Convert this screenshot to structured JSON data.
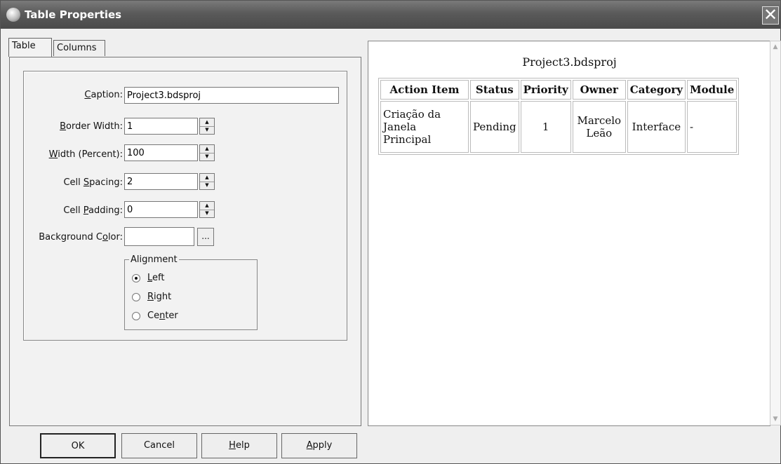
{
  "window": {
    "title": "Table Properties",
    "close_glyph": "✕"
  },
  "tabs": [
    {
      "label": "Table"
    },
    {
      "label": "Columns"
    }
  ],
  "form": {
    "caption": {
      "label_pre": "",
      "label_u": "C",
      "label_post": "aption:",
      "value": "Project3.bdsproj"
    },
    "border_width": {
      "label_pre": "",
      "label_u": "B",
      "label_post": "order Width:",
      "value": "1"
    },
    "width_percent": {
      "label_pre": "",
      "label_u": "W",
      "label_post": "idth (Percent):",
      "value": "100"
    },
    "cell_spacing": {
      "label_pre": "Cell ",
      "label_u": "S",
      "label_post": "pacing:",
      "value": "2"
    },
    "cell_padding": {
      "label_pre": "Cell ",
      "label_u": "P",
      "label_post": "adding:",
      "value": "0"
    },
    "background_color": {
      "label_pre": "Background C",
      "label_u": "o",
      "label_post": "lor:",
      "value": "",
      "button": "..."
    }
  },
  "alignment": {
    "legend": "Alignment",
    "options": [
      {
        "pre": "",
        "u": "L",
        "post": "eft",
        "selected": true
      },
      {
        "pre": "",
        "u": "R",
        "post": "ight",
        "selected": false
      },
      {
        "pre": "Ce",
        "u": "n",
        "post": "ter",
        "selected": false
      }
    ]
  },
  "buttons": [
    {
      "pre": "OK",
      "u": "",
      "post": ""
    },
    {
      "pre": "Cancel",
      "u": "",
      "post": ""
    },
    {
      "pre": "",
      "u": "H",
      "post": "elp"
    },
    {
      "pre": "",
      "u": "A",
      "post": "pply"
    }
  ],
  "preview": {
    "caption": "Project3.bdsproj",
    "headers": [
      "Action Item",
      "Status",
      "Priority",
      "Owner",
      "Category",
      "Module"
    ],
    "row": [
      "Criação da Janela Principal",
      "Pending",
      "1",
      "Marcelo Leão",
      "Interface",
      "-"
    ]
  },
  "icons": {
    "scroll_up": "up-arrow-icon",
    "scroll_down": "down-arrow-icon",
    "spin_up": "spin-up-icon",
    "spin_down": "spin-down-icon"
  }
}
